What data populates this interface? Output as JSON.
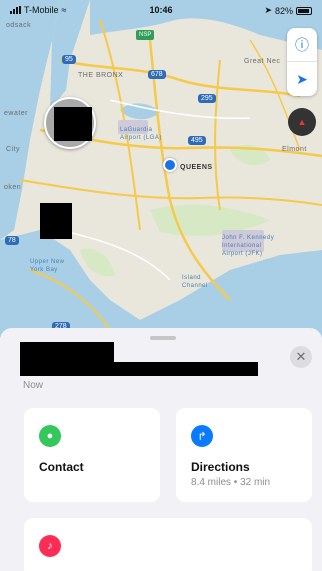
{
  "status_bar": {
    "carrier": "T-Mobile",
    "time": "10:46",
    "battery": "82%"
  },
  "map": {
    "labels": {
      "nj_edge": "odsack",
      "bronx": "THE BRONX",
      "great_neck": "Great Nec",
      "water_left": "ewater",
      "la_guardia": "LaGuardia Airport (LGA)",
      "queens": "QUEENS",
      "elmont": "Elmont",
      "city": "City",
      "oken": "oken",
      "jfk": "John F. Kennedy International Airport (JFK)",
      "upper_ny_bay": "Upper New York Bay",
      "island_channel": "Island Channel"
    },
    "shields": {
      "i95": "95",
      "i678": "678",
      "i295": "295",
      "i495": "495",
      "i78": "78",
      "i278": "278"
    },
    "highway_badge": "NSP"
  },
  "sheet": {
    "time_label": "Now",
    "close_glyph": "✕",
    "actions": {
      "contact": {
        "label": "Contact"
      },
      "directions": {
        "label": "Directions",
        "detail": "8.4 miles • 32 min"
      }
    }
  },
  "colors": {
    "accent": "#0a7aff",
    "contact_icon": "#34c759",
    "notify_icon": "#ff2d55",
    "user_location": "#1a73e8"
  }
}
